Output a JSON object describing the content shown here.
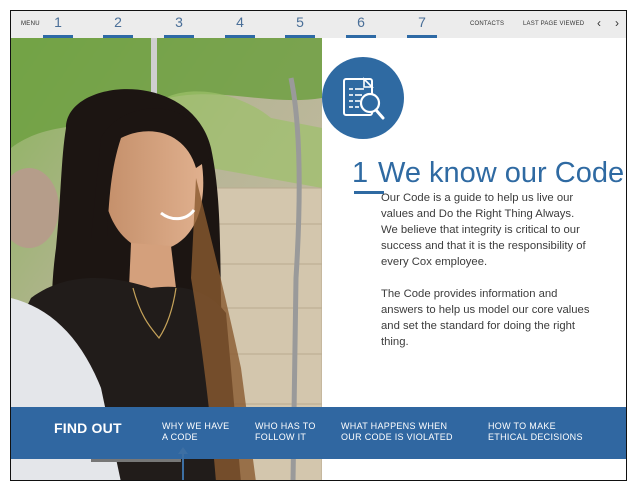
{
  "topbar": {
    "menu_label": "MENU",
    "pages": [
      "1",
      "2",
      "3",
      "4",
      "5",
      "6",
      "7"
    ],
    "contacts_label": "CONTACTS",
    "last_page_label": "LAST PAGE VIEWED",
    "prev_icon": "‹",
    "next_icon": "›"
  },
  "hero": {
    "icon": "document-magnifier-icon",
    "number": "1",
    "title": "We know our Code",
    "paragraph1": "Our Code is a guide to help us live our values and Do the Right Thing Always. We believe that integrity is critical to our success and that it is the responsibility of every Cox employee.",
    "paragraph2": "The Code provides information and answers to help us model our core values and set the standard for doing the right thing."
  },
  "find_out": {
    "title": "FIND OUT",
    "items": [
      {
        "line1": "WHY WE HAVE",
        "line2": "A CODE"
      },
      {
        "line1": "WHO HAS TO",
        "line2": "FOLLOW IT"
      },
      {
        "line1": "WHAT HAPPENS WHEN",
        "line2": "OUR CODE IS VIOLATED"
      },
      {
        "line1": "HOW TO MAKE",
        "line2": "ETHICAL DECISIONS"
      }
    ]
  },
  "colors": {
    "accent": "#2f6aa2",
    "topbar_bg": "#ececec",
    "findout_bg": "#3067a1"
  }
}
